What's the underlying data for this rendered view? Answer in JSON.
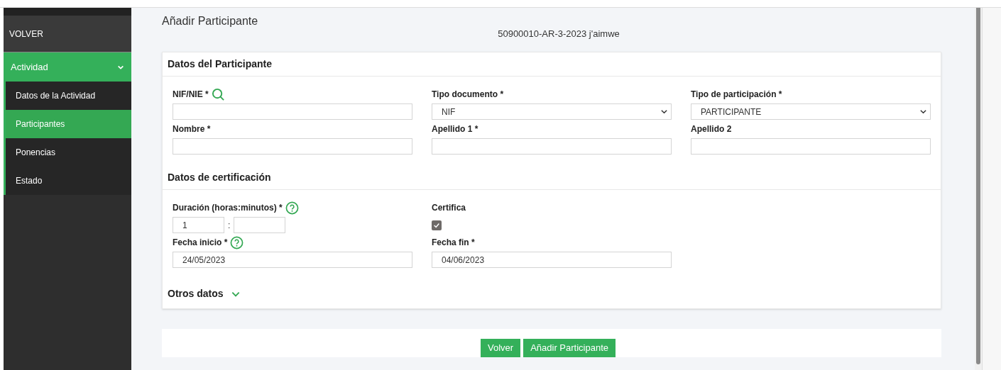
{
  "sidebar": {
    "back": "VOLVER",
    "section": {
      "label": "Actividad",
      "expanded": true
    },
    "items": [
      {
        "label": "Datos de la Actividad",
        "selected": false
      },
      {
        "label": "Participantes",
        "selected": true
      },
      {
        "label": "Ponencias",
        "selected": false
      },
      {
        "label": "Estado",
        "selected": false
      }
    ]
  },
  "page_title": "Añadir Participante",
  "subtitle": "50900010-AR-3-2023 j'aimwe",
  "participant_section": {
    "title": "Datos del Participante",
    "fields": [
      {
        "label": "NIF/NIE *",
        "kind": "text",
        "search": true
      },
      {
        "label": "Tipo documento *",
        "kind": "select",
        "value": "NIF"
      },
      {
        "label": "Tipo de participación *",
        "kind": "select",
        "value": "PARTICIPANTE"
      },
      {
        "label": "Nombre *",
        "kind": "text"
      },
      {
        "label": "Apellido 1 *",
        "kind": "text"
      },
      {
        "label": "Apellido 2",
        "kind": "text"
      }
    ]
  },
  "certification_section": {
    "title": "Datos de certificación",
    "duration": {
      "label": "Duración (horas:minutos) *",
      "hours": "1",
      "separator": ":"
    },
    "certifica": {
      "label": "Certifica",
      "checked": true
    },
    "start_date": {
      "label": "Fecha inicio *",
      "value": "24/05/2023"
    },
    "end_date": {
      "label": "Fecha fin *",
      "value": "04/06/2023"
    }
  },
  "other_section": {
    "title": "Otros datos",
    "expanded": false
  },
  "buttons": [
    "Volver",
    "Añadir Participante"
  ]
}
